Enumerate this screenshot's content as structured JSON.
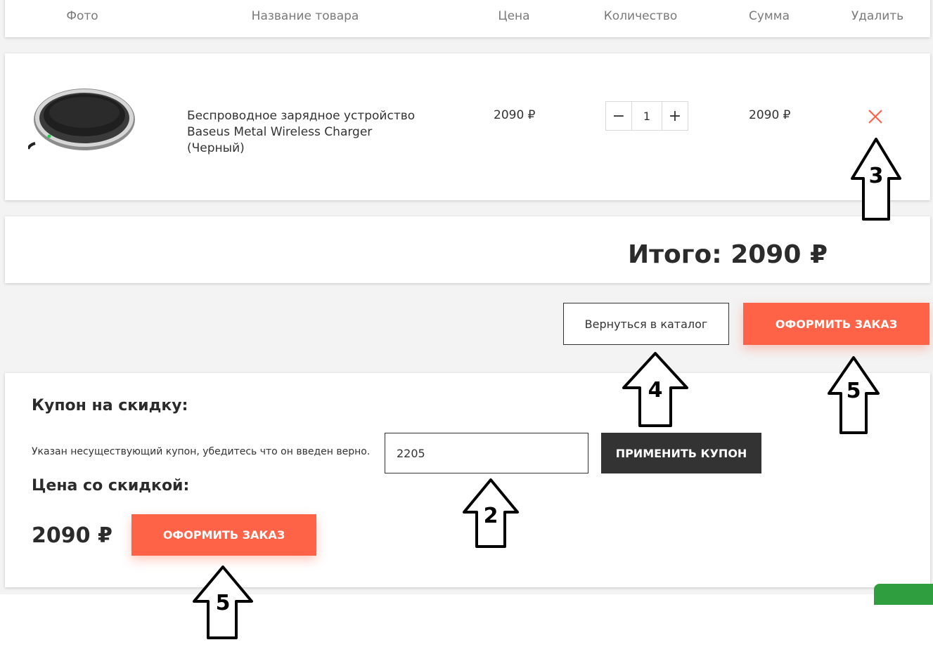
{
  "table_headers": {
    "photo": "Фото",
    "name": "Название товара",
    "price": "Цена",
    "quantity": "Количество",
    "sum": "Сумма",
    "remove": "Удалить"
  },
  "cart_item": {
    "name": "Беспроводное зарядное устройство Baseus Metal Wireless Charger (Черный)",
    "price": "2090 ₽",
    "quantity": "1",
    "sum": "2090 ₽",
    "decrement_label": "−",
    "increment_label": "+"
  },
  "total": {
    "text": "Итого: 2090 ₽"
  },
  "actions": {
    "back_to_catalog": "Вернуться в каталог",
    "place_order": "ОФОРМИТЬ ЗАКАЗ"
  },
  "coupon": {
    "title": "Купон на скидку:",
    "message": "Указан несуществующий купон, убедитесь что он введен верно.",
    "input_value": "2205",
    "apply_label": "ПРИМЕНИТЬ КУПОН",
    "discount_title": "Цена со скидкой:",
    "discount_price": "2090 ₽",
    "place_order": "ОФОРМИТЬ ЗАКАЗ"
  },
  "annotations": {
    "arrow_remove": "3",
    "arrow_back": "4",
    "arrow_order_top": "5",
    "arrow_coupon": "2",
    "arrow_order_bottom": "5"
  },
  "colors": {
    "accent": "#ff6347",
    "dark_button": "#333333",
    "remove_icon": "#ff6347",
    "chat_tab": "#2e9e3e"
  }
}
